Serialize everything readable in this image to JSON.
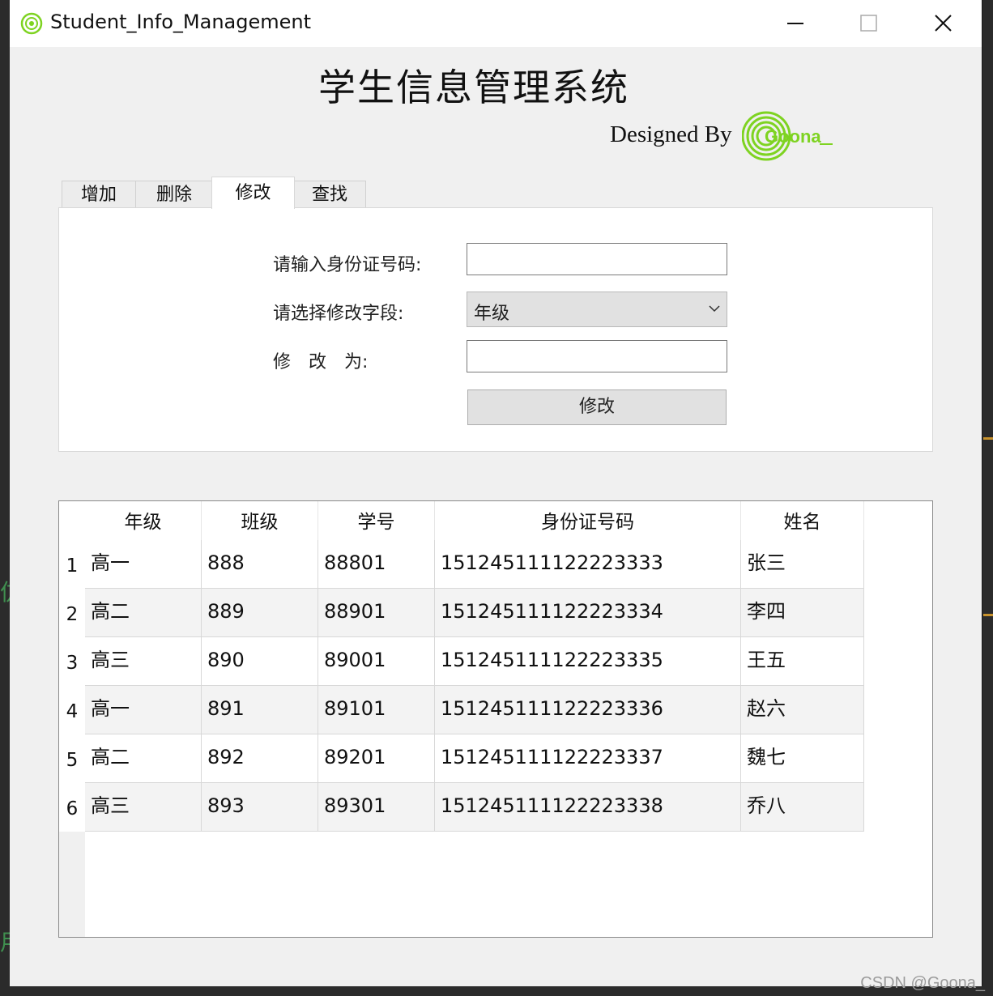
{
  "window": {
    "title": "Student_Info_Management"
  },
  "header": {
    "title": "学生信息管理系统",
    "designed_by": "Designed By",
    "logo_text": "Goona"
  },
  "tabs": [
    {
      "label": "增加",
      "active": false
    },
    {
      "label": "删除",
      "active": false
    },
    {
      "label": "修改",
      "active": true
    },
    {
      "label": "查找",
      "active": false
    }
  ],
  "form": {
    "id_label": "请输入身份证号码:",
    "id_value": "",
    "field_label": "请选择修改字段:",
    "field_selected": "年级",
    "new_value_label": "修　改　为:",
    "new_value": "",
    "submit_label": "修改"
  },
  "table": {
    "columns": [
      "年级",
      "班级",
      "学号",
      "身份证号码",
      "姓名"
    ],
    "rows": [
      {
        "num": "1",
        "cells": [
          "高一",
          "888",
          "88801",
          "151245111122223333",
          "张三"
        ]
      },
      {
        "num": "2",
        "cells": [
          "高二",
          "889",
          "88901",
          "151245111122223334",
          "李四"
        ]
      },
      {
        "num": "3",
        "cells": [
          "高三",
          "890",
          "89001",
          "151245111122223335",
          "王五"
        ]
      },
      {
        "num": "4",
        "cells": [
          "高一",
          "891",
          "89101",
          "151245111122223336",
          "赵六"
        ]
      },
      {
        "num": "5",
        "cells": [
          "高二",
          "892",
          "89201",
          "151245111122223337",
          "魏七"
        ]
      },
      {
        "num": "6",
        "cells": [
          "高三",
          "893",
          "89301",
          "151245111122223338",
          "乔八"
        ]
      }
    ]
  },
  "watermark": "CSDN @Goona_",
  "colors": {
    "logo_green": "#7ed321",
    "row_alt": "#f3f3f3"
  }
}
